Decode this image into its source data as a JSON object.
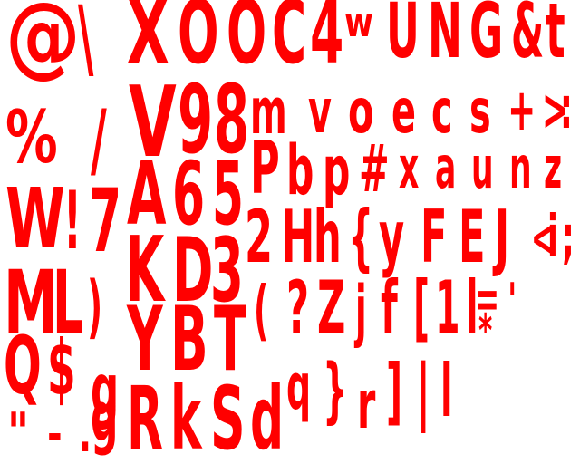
{
  "color": "#ff0000",
  "glyphs": [
    {
      "c": "@"
    },
    {
      "c": "\\"
    },
    {
      "c": "X"
    },
    {
      "c": "O"
    },
    {
      "c": "O"
    },
    {
      "c": "C"
    },
    {
      "c": "4"
    },
    {
      "c": "w"
    },
    {
      "c": "U"
    },
    {
      "c": "N"
    },
    {
      "c": "G"
    },
    {
      "c": "&"
    },
    {
      "c": "t"
    },
    {
      "c": "%"
    },
    {
      "c": "/"
    },
    {
      "c": "V"
    },
    {
      "c": "9"
    },
    {
      "c": "8"
    },
    {
      "c": "m"
    },
    {
      "c": "v"
    },
    {
      "c": "o"
    },
    {
      "c": "e"
    },
    {
      "c": "c"
    },
    {
      "c": "s"
    },
    {
      "c": "+"
    },
    {
      "c": ">"
    },
    {
      "c": ":"
    },
    {
      "c": "A"
    },
    {
      "c": "6"
    },
    {
      "c": "5"
    },
    {
      "c": "P"
    },
    {
      "c": "b"
    },
    {
      "c": "p"
    },
    {
      "c": "#"
    },
    {
      "c": "x"
    },
    {
      "c": "a"
    },
    {
      "c": "u"
    },
    {
      "c": "n"
    },
    {
      "c": "z"
    },
    {
      "c": "W"
    },
    {
      "c": "!"
    },
    {
      "c": "7"
    },
    {
      "c": "2"
    },
    {
      "c": "H"
    },
    {
      "c": "h"
    },
    {
      "c": "{"
    },
    {
      "c": "y"
    },
    {
      "c": "F"
    },
    {
      "c": "E"
    },
    {
      "c": "J"
    },
    {
      "c": "<"
    },
    {
      "c": "i"
    },
    {
      "c": ";"
    },
    {
      "c": "K"
    },
    {
      "c": "D"
    },
    {
      "c": "3"
    },
    {
      "c": "M"
    },
    {
      "c": "L"
    },
    {
      "c": ")"
    },
    {
      "c": "("
    },
    {
      "c": "?"
    },
    {
      "c": "Z"
    },
    {
      "c": "j"
    },
    {
      "c": "f"
    },
    {
      "c": "["
    },
    {
      "c": "1"
    },
    {
      "c": "l"
    },
    {
      "c": "="
    },
    {
      "c": "'"
    },
    {
      "c": "*"
    },
    {
      "c": "Y"
    },
    {
      "c": "B"
    },
    {
      "c": "T"
    },
    {
      "c": "Q"
    },
    {
      "c": "$"
    },
    {
      "c": "g"
    },
    {
      "c": "g"
    },
    {
      "c": "q"
    },
    {
      "c": "}"
    },
    {
      "c": "r"
    },
    {
      "c": "]"
    },
    {
      "c": "|"
    },
    {
      "c": "l"
    },
    {
      "c": "R"
    },
    {
      "c": "k"
    },
    {
      "c": "S"
    },
    {
      "c": "d"
    },
    {
      "c": "\""
    },
    {
      "c": "-"
    },
    {
      "c": "."
    }
  ]
}
